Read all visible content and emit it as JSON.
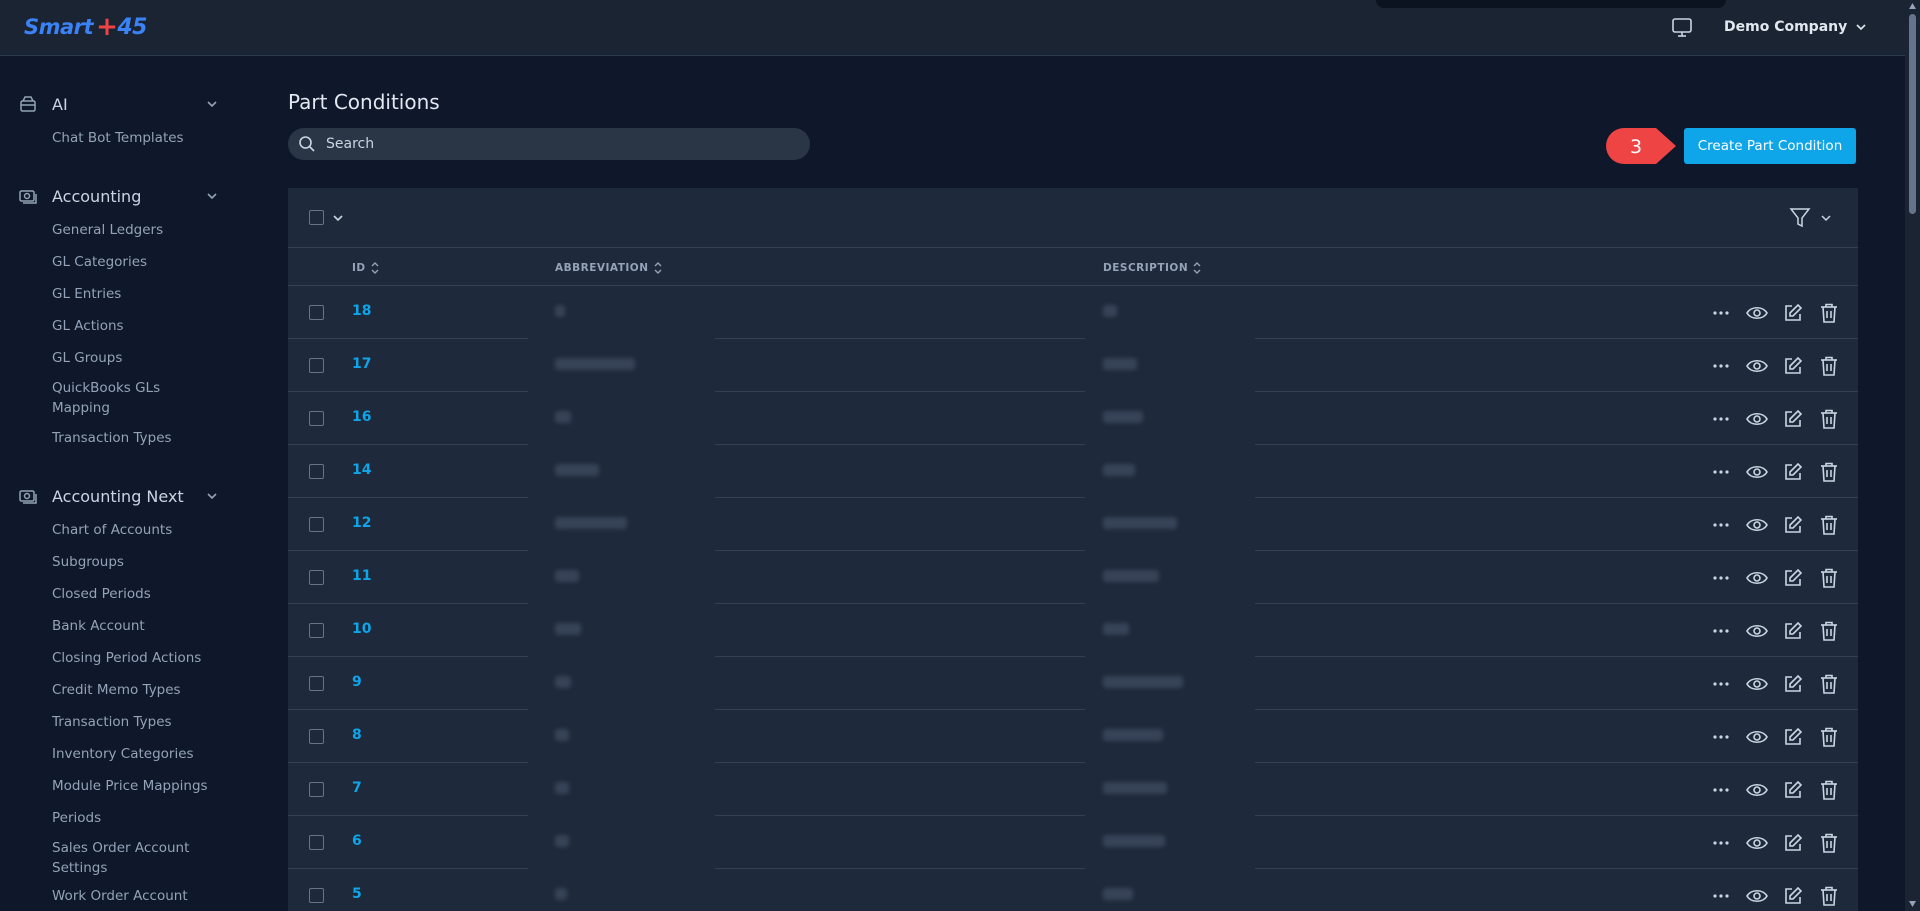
{
  "app": {
    "logo_text": "Smart",
    "logo_plus": "+",
    "logo_num": "45",
    "company": "Demo Company"
  },
  "sidebar": {
    "sections": [
      {
        "label": "AI",
        "items": [
          "Chat Bot Templates"
        ]
      },
      {
        "label": "Accounting",
        "items": [
          "General Ledgers",
          "GL Categories",
          "GL Entries",
          "GL Actions",
          "GL Groups",
          "QuickBooks GLs Mapping",
          "Transaction Types"
        ]
      },
      {
        "label": "Accounting Next",
        "items": [
          "Chart of Accounts",
          "Subgroups",
          "Closed Periods",
          "Bank Account",
          "Closing Period Actions",
          "Credit Memo Types",
          "Transaction Types",
          "Inventory Categories",
          "Module Price Mappings",
          "Periods",
          "Sales Order Account Settings",
          "Work Order Account"
        ]
      }
    ]
  },
  "main": {
    "title": "Part Conditions",
    "search_placeholder": "Search",
    "create_button": "Create Part Condition",
    "step_marker": "3",
    "columns": {
      "id": "ID",
      "abbreviation": "ABBREVIATION",
      "description": "DESCRIPTION"
    },
    "rows": [
      {
        "id": "18"
      },
      {
        "id": "17"
      },
      {
        "id": "16"
      },
      {
        "id": "14"
      },
      {
        "id": "12"
      },
      {
        "id": "11"
      },
      {
        "id": "10"
      },
      {
        "id": "9"
      },
      {
        "id": "8"
      },
      {
        "id": "7"
      },
      {
        "id": "6"
      },
      {
        "id": "5"
      }
    ]
  },
  "colors": {
    "accent": "#0ea5e9",
    "marker": "#ef4444",
    "bg": "#0f172a",
    "panel": "#1e293b"
  }
}
